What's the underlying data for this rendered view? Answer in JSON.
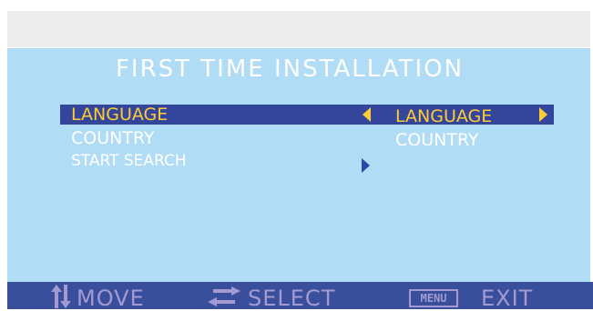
{
  "osd": {
    "title": "FIRST TIME INSTALLATION",
    "menu_items": [
      {
        "label": "LANGUAGE"
      },
      {
        "label": "COUNTRY"
      },
      {
        "label": "START SEARCH"
      }
    ],
    "values": {
      "language": "LANGUAGE",
      "country": "COUNTRY"
    }
  },
  "footer": {
    "move_label": "MOVE",
    "select_label": "SELECT",
    "menu_key": "MENU",
    "exit_label": "EXIT"
  },
  "icons": {
    "move": "up-down-arrows-icon",
    "select": "left-right-arrows-icon"
  },
  "colors": {
    "background": "#b1dcf5",
    "highlight": "#33469c",
    "selected_text": "#ffcc33",
    "footer": "#3a4f9c",
    "footer_text": "#a29ad1"
  }
}
